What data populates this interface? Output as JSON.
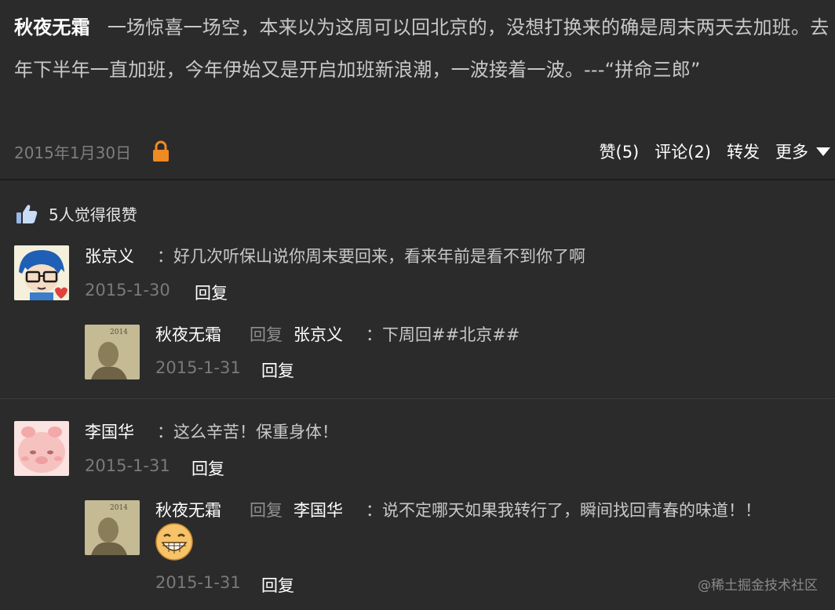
{
  "post": {
    "author": "秋夜无霜",
    "text": "一场惊喜一场空，本来以为这周可以回北京的，没想打换来的确是周末两天去加班。去年下半年一直加班，今年伊始又是开启加班新浪潮，一波接着一波。---“拼命三郎”",
    "date": "2015年1月30日",
    "lock_icon": "lock-icon",
    "actions": {
      "like": "赞(5)",
      "comment": "评论(2)",
      "share": "转发",
      "more": "更多"
    }
  },
  "likes": {
    "icon": "thumbs-up-icon",
    "text": "5人觉得很赞"
  },
  "comments": [
    {
      "author": "张京义",
      "text": "：好几次听保山说你周末要回来，看来年前是看不到你了啊",
      "date": "2015-1-30",
      "reply_label": "回复",
      "reply": {
        "author": "秋夜无霜",
        "reply_word": "回复",
        "target": "张京义",
        "text": "：下周回##北京##",
        "date": "2015-1-31",
        "reply_label": "回复"
      }
    },
    {
      "author": "李国华",
      "text": "：这么辛苦！保重身体！",
      "date": "2015-1-31",
      "reply_label": "回复",
      "reply": {
        "author": "秋夜无霜",
        "reply_word": "回复",
        "target": "李国华",
        "text": "：说不定哪天如果我转行了，瞬间找回青春的味道！！",
        "emoji": "grin-emoji-icon",
        "date": "2015-1-31",
        "reply_label": "回复"
      }
    }
  ],
  "watermark": "@稀土掘金技术社区",
  "colors": {
    "background": "#2b2b2b",
    "lock": "#f08a24",
    "thumb": "#9ab8e6"
  }
}
